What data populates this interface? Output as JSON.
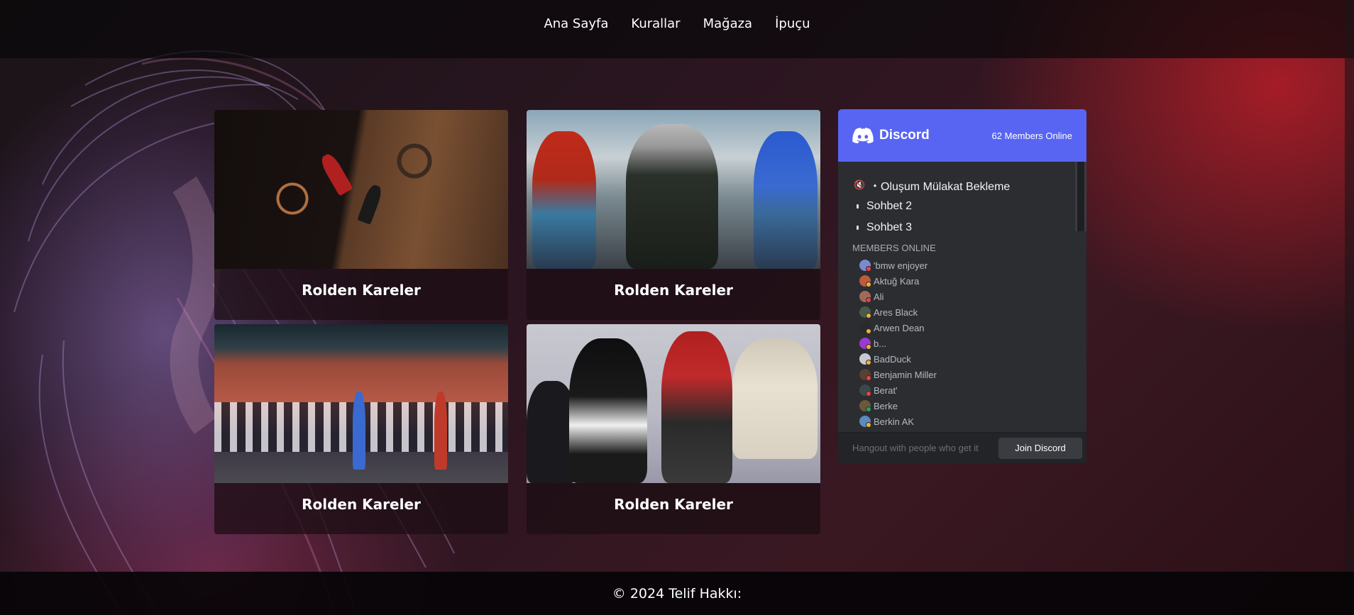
{
  "nav": {
    "items": [
      "Ana Sayfa",
      "Kurallar",
      "Mağaza",
      "İpuçu"
    ]
  },
  "gallery": {
    "cards": [
      {
        "title": "Rolden Kareler"
      },
      {
        "title": "Rolden Kareler"
      },
      {
        "title": "Rolden Kareler"
      },
      {
        "title": "Rolden Kareler"
      }
    ]
  },
  "discord": {
    "brand": "Discord",
    "online_count": "62 Members Online",
    "channels": [
      "・Oluşum Mülakat Bekleme",
      "Sohbet 2",
      "Sohbet 3"
    ],
    "members_heading": "MEMBERS ONLINE",
    "members": [
      {
        "name": "'bmw enjoyer",
        "color": "#7a8ad0",
        "status": "#f23f43"
      },
      {
        "name": "Aktuğ Kara",
        "color": "#c05a3a",
        "status": "#f0b232"
      },
      {
        "name": "Ali",
        "color": "#a06a5a",
        "status": "#f23f43"
      },
      {
        "name": "Ares Black",
        "color": "#4a5a4a",
        "status": "#f0b232"
      },
      {
        "name": "Arwen Dean",
        "color": "#2a2a2a",
        "status": "#f0b232"
      },
      {
        "name": "b...",
        "color": "#9a3ad0",
        "status": "#f0b232"
      },
      {
        "name": "BadDuck",
        "color": "#c8c8d0",
        "status": "#f0b232"
      },
      {
        "name": "Benjamin Miller",
        "color": "#5a4030",
        "status": "#f23f43"
      },
      {
        "name": "Berat'",
        "color": "#3a4a4a",
        "status": "#f23f43"
      },
      {
        "name": "Berke",
        "color": "#6a5a3a",
        "status": "#23a55a"
      },
      {
        "name": "Berkin AK",
        "color": "#5a8ac0",
        "status": "#f0b232"
      }
    ],
    "footer_text": "Hangout with people who get it",
    "join_label": "Join Discord"
  },
  "footer": {
    "copyright": "© 2024 Telif Hakkı:"
  },
  "colors": {
    "discord_blurple": "#5865f2",
    "discord_bg": "#2b2d31",
    "card_bg": "#1e0e14"
  }
}
